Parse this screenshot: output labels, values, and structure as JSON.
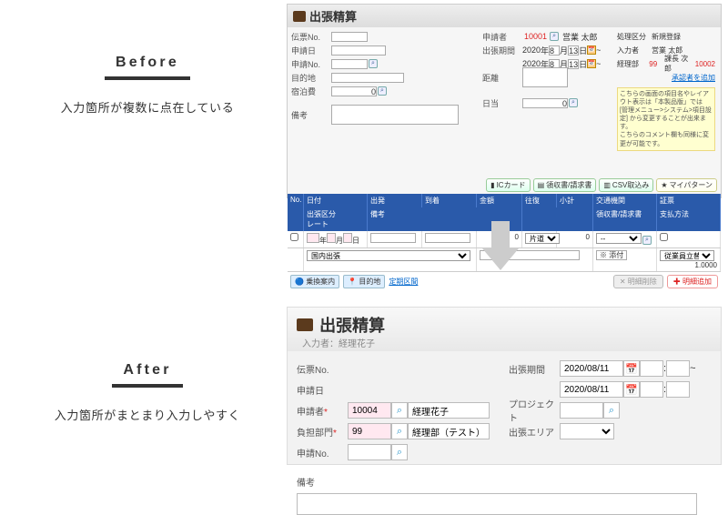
{
  "left": {
    "before_title": "Before",
    "before_desc": "入力箇所が複数に点在している",
    "after_title": "After",
    "after_desc": "入力箇所がまとまり入力しやすく"
  },
  "before": {
    "title": "出張精算",
    "tr_label_no": "伝票No.",
    "tr_label_appdate": "申請日",
    "tr_label_appno": "申請No.",
    "tr_label_dest": "目的地",
    "tr_label_stay": "宿泊費",
    "tr_label_memo": "備考",
    "tr_label_applicant": "申請者",
    "applicant_id": "10001",
    "applicant_name": "営業 太郎",
    "tr_label_period": "出張期間",
    "period_from_y": "2020",
    "period_from_m": "8",
    "period_from_d": "13",
    "period_to_y": "2020",
    "period_to_m": "8",
    "period_to_d": "13",
    "tr_label_dist": "距離",
    "stay_val": "0",
    "tr_label_daily": "日当",
    "daily_val": "0",
    "top_r1_lbl1": "処理区分",
    "top_r1_lbl2": "新規登録",
    "top_r1_lbl3": "入力者",
    "top_r1_lbl4": "営業 太郎",
    "top_r2_lbl1": "経理部",
    "top_r2_lbl2": "課長 次郎",
    "top_r2_v1": "99",
    "top_r2_v2": "10002",
    "link_add": "承認者を追加",
    "note1": "こちらの画面の項目名やレイアウト表示は「本製品版」では",
    "note2": "[管理メニュー>システム>項目設定] から変更することが出来ます。",
    "note3": "こちらのコメント欄も同様に変更が可能です。",
    "btn_ic": "ICカード",
    "btn_receipt": "領収書/請求書",
    "btn_csv": "CSV取込み",
    "btn_pat": "マイパターン",
    "th_no": "No.",
    "th_date": "日付",
    "th_dep": "出発",
    "th_arr": "到着",
    "th_amt": "金額",
    "th_ow": "往復",
    "th_sub": "小計",
    "th_tr": "交通機関",
    "th_ev": "証票",
    "th_div": "出張区分",
    "th_rate": "レート",
    "th_memo": "備考",
    "th_rcpt": "領収書/請求書",
    "th_pay": "支払方法",
    "row_y": "年",
    "row_m": "月",
    "row_d": "日",
    "row_amt": "0",
    "row_ow": "片道",
    "row_sub": "0",
    "row_tr": "--",
    "row_div": "国内出張",
    "row_add": "※ 添付",
    "row_pay": "従業員立替",
    "row_rate": "1.0000",
    "fb_transfer": "乗換案内",
    "fb_dest": "目的地",
    "fb_route": "定期区間",
    "btn_del": "明細削除",
    "btn_addr": "明細追加"
  },
  "after": {
    "title": "出張精算",
    "sub": "入力者：経理花子",
    "lbl_no": "伝票No.",
    "lbl_date": "申請日",
    "lbl_applicant": "申請者",
    "applicant_id": "10004",
    "applicant_name": "経理花子",
    "lbl_dept": "負担部門",
    "dept_id": "99",
    "dept_name": "経理部（テスト）",
    "lbl_appno": "申請No.",
    "lbl_memo": "備考",
    "lbl_period": "出張期間",
    "date_from": "2020/08/11",
    "date_to": "2020/08/11",
    "lbl_proj": "プロジェクト",
    "lbl_area": "出張エリア"
  }
}
